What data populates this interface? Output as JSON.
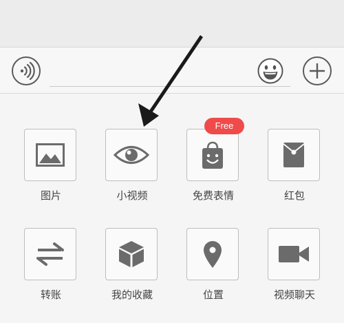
{
  "input_bar": {
    "text_value": ""
  },
  "panel": {
    "items": [
      {
        "label": "图片",
        "icon": "image-icon"
      },
      {
        "label": "小视频",
        "icon": "eye-icon"
      },
      {
        "label": "免费表情",
        "icon": "sticker-bag-icon",
        "badge": "Free"
      },
      {
        "label": "红包",
        "icon": "red-packet-icon"
      },
      {
        "label": "转账",
        "icon": "transfer-arrows-icon"
      },
      {
        "label": "我的收藏",
        "icon": "favorites-box-icon"
      },
      {
        "label": "位置",
        "icon": "location-pin-icon"
      },
      {
        "label": "视频聊天",
        "icon": "video-camera-icon"
      }
    ]
  },
  "colors": {
    "icon_gray": "#6b6b6b",
    "badge_red": "#ef4b4b",
    "annotation_arrow": "#1a1a1a"
  }
}
